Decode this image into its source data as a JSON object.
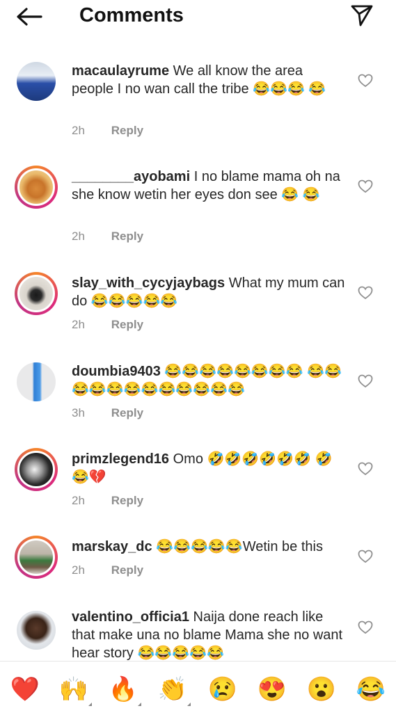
{
  "header": {
    "title": "Comments",
    "back_icon": "arrow-left-icon",
    "share_icon": "paper-plane-icon"
  },
  "comments": [
    {
      "username": "macaulayrume",
      "text": "We all know the area people I no wan call the tribe 😂😂😂 😂",
      "time": "2h",
      "reply": "Reply",
      "avatar_icon": "avatar-man-photo",
      "ring": false
    },
    {
      "username": "________ayobami",
      "text": "I no blame mama oh na she know wetin her eyes don see 😂 😂",
      "time": "2h",
      "reply": "Reply",
      "avatar_icon": "avatar-cartoon-dog",
      "ring": true
    },
    {
      "username": "slay_with_cycyjaybags",
      "text": "What my mum can do 😂😂😂😂😂",
      "time": "2h",
      "reply": "Reply",
      "avatar_icon": "avatar-handbag",
      "ring": true
    },
    {
      "username": "doumbia9403",
      "text": "😂😂😂😂😂😂😂😂 😂😂😂😂😂😂😂😂😂😂😂😂",
      "time": "3h",
      "reply": "Reply",
      "avatar_icon": "avatar-woman-blue-dress",
      "ring": false
    },
    {
      "username": "primzlegend16",
      "text": "Omo 🤣🤣🤣🤣🤣🤣 🤣😂💔",
      "time": "2h",
      "reply": "Reply",
      "avatar_icon": "avatar-bw-photo",
      "ring": true
    },
    {
      "username": "marskay_dc",
      "text": "😂😂😂😂😂Wetin be this",
      "time": "2h",
      "reply": "Reply",
      "avatar_icon": "avatar-room-photo",
      "ring": true
    },
    {
      "username": "valentino_officia1",
      "text": "Naija done reach like that make una no blame Mama she no want hear story 😂😂😂😂😂",
      "time": "",
      "reply": "",
      "avatar_icon": "avatar-man-glasses",
      "ring": false
    }
  ],
  "emoji_bar": [
    {
      "char": "❤️",
      "icon": "heart-emoji",
      "corner": false
    },
    {
      "char": "🙌",
      "icon": "raising-hands-emoji",
      "corner": true
    },
    {
      "char": "🔥",
      "icon": "fire-emoji",
      "corner": true
    },
    {
      "char": "👏",
      "icon": "clapping-hands-emoji",
      "corner": true
    },
    {
      "char": "😢",
      "icon": "crying-face-emoji",
      "corner": false
    },
    {
      "char": "😍",
      "icon": "heart-eyes-emoji",
      "corner": false
    },
    {
      "char": "😮",
      "icon": "surprised-face-emoji",
      "corner": false
    },
    {
      "char": "😂",
      "icon": "tears-of-joy-emoji",
      "corner": false
    }
  ],
  "colors": {
    "text": "#262626",
    "meta": "#8e8e8e",
    "ring_start": "#f58529",
    "ring_end": "#dd2a7b"
  }
}
